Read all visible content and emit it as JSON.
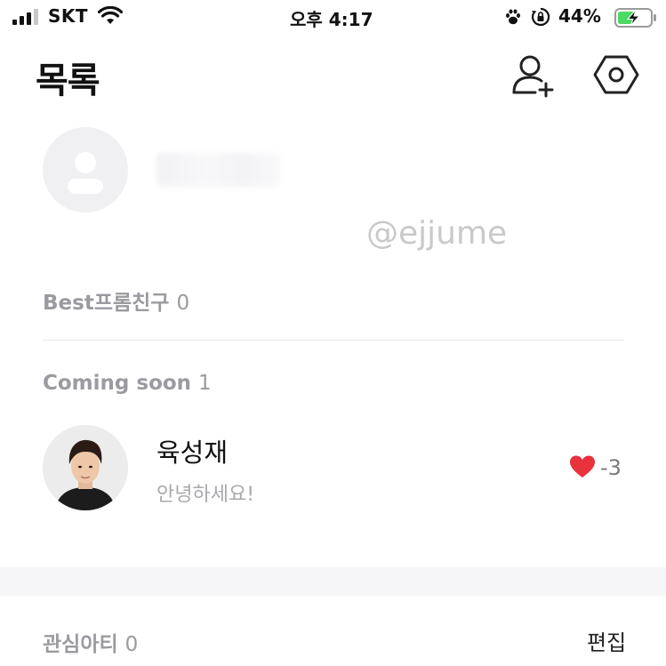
{
  "status_bar": {
    "carrier": "SKT",
    "time": "오후 4:17",
    "battery": "44%"
  },
  "header": {
    "title": "목록",
    "icons": [
      "add-friend-icon",
      "settings-icon"
    ]
  },
  "watermark": "@ejjume",
  "sections": {
    "best": {
      "label": "Best프롬친구",
      "count": "0"
    },
    "coming": {
      "label": "Coming soon",
      "count": "1"
    },
    "interest": {
      "label": "관심아티",
      "count": "0",
      "action": "편집"
    }
  },
  "friends": [
    {
      "name": "육성재",
      "status": "안녕하세요!",
      "likes": "-3"
    }
  ],
  "colors": {
    "heart": "#e8323c",
    "battery_fill": "#4cd964",
    "muted_text": "#9a9aa0"
  }
}
